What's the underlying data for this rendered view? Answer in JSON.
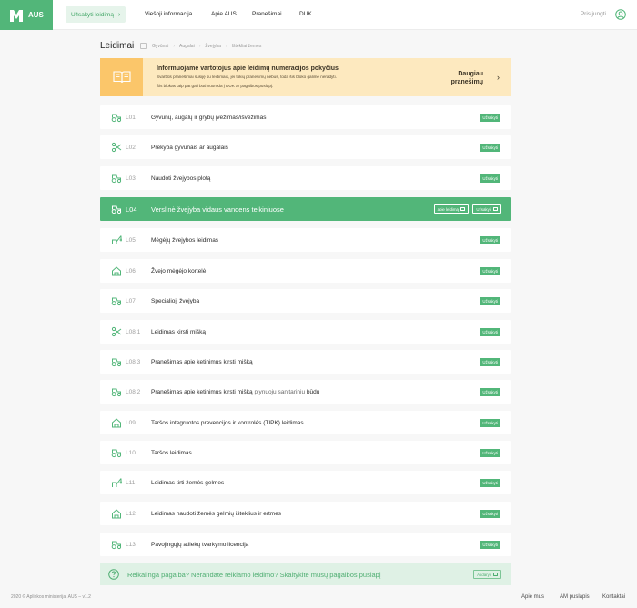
{
  "header": {
    "brand": "AUS",
    "order_button": "Užsakyti leidimą",
    "nav": [
      "Viešoji informacija",
      "Apie AUS",
      "Pranešimai",
      "DUK"
    ],
    "login": "Prisijungti"
  },
  "page": {
    "title": "Leidimai",
    "breadcrumb": [
      "Gyvūnai",
      "Augalai",
      "Žvejyba",
      "Ištekliai žemės"
    ]
  },
  "notice": {
    "title": "Informuojame vartotojus apie leidimų numeracijos pokyčius",
    "line1": "Svarbūs pranešimai susiję su leidimais, jei tokių pranešimų nebus, toda šis bloko galime neradyti.",
    "line2": "Šis blokas taip pat gali būti nuoroda į DUK ar pagalbos puslapį.",
    "more_line1": "Daugiau",
    "more_line2": "pranešimų"
  },
  "permits": [
    {
      "code": "L01",
      "title": "Gyvūnų, augalų ir grybų įvežimas/išvežimas",
      "icon": "tractor-icon",
      "order": "Užsakyti"
    },
    {
      "code": "L02",
      "title": "Prekyba gyvūnais ar augalais",
      "icon": "scissors-icon",
      "order": "Užsakyti"
    },
    {
      "code": "L03",
      "title": "Naudoti žvejybos plotą",
      "icon": "tractor-icon",
      "order": "Užsakyti"
    },
    {
      "code": "L04",
      "title": "Verslinė žvejyba vidaus vandens telkiniuose",
      "icon": "tractor-icon",
      "order": "Užsakyti",
      "about": "apie leidimą",
      "active": true
    },
    {
      "code": "L05",
      "title": "Mėgėjų žvejybos leidimas",
      "icon": "fishing-rod-icon",
      "order": "Užsakyti"
    },
    {
      "code": "L06",
      "title": "Žvejo mėgėjo kortelė",
      "icon": "house-icon",
      "order": "Užsakyti"
    },
    {
      "code": "L07",
      "title": "Specialioji žvejyba",
      "icon": "tractor-icon",
      "order": "Užsakyti"
    },
    {
      "code": "L08.1",
      "title": "Leidimas kirsti mišką",
      "icon": "scissors-icon",
      "order": "Užsakyti"
    },
    {
      "code": "L08.3",
      "title": "Pranešimas apie ketinimus kirsti mišką",
      "icon": "tractor-icon",
      "order": "Užsakyti"
    },
    {
      "code": "L08.2",
      "title": "Pranešimas apie ketinimus kirsti mišką",
      "title_extra": "plynuoju sanitariniu",
      "title_end": "būdu",
      "icon": "tractor-icon",
      "order": "Užsakyti"
    },
    {
      "code": "L09",
      "title": "Taršos integruotos prevencijos ir kontrolės (TIPK) leidimas",
      "icon": "house-icon",
      "order": "Užsakyti"
    },
    {
      "code": "L10",
      "title": "Taršos leidimas",
      "icon": "tractor-icon",
      "order": "Užsakyti"
    },
    {
      "code": "L11",
      "title": "Leidimas tirti žemės gelmes",
      "icon": "fishing-rod-icon",
      "order": "Užsakyti"
    },
    {
      "code": "L12",
      "title": "Leidimas naudoti žemės gelmių išteklius ir ertmes",
      "icon": "house-icon",
      "order": "Užsakyti"
    },
    {
      "code": "L13",
      "title": "Pavojingųjų atliekų tvarkymo licencija",
      "icon": "tractor-icon",
      "order": "Užsakyti"
    }
  ],
  "help": {
    "text": "Reikalinga pagalba? Nerandate reikiamo leidimo? Skaitykite mūsų pagalbos puslapį",
    "button": "Atidaryti"
  },
  "footer": {
    "copyright": "2020 © Aplinkos ministerija, AUS – v1.2",
    "links": [
      "Apie mus",
      "AM puslapis",
      "Kontaktai"
    ]
  },
  "colors": {
    "brand": "#52b679",
    "notice_bg": "#fde9bf",
    "notice_icon_bg": "#fbc66a",
    "help_bg": "#dff1e5"
  }
}
